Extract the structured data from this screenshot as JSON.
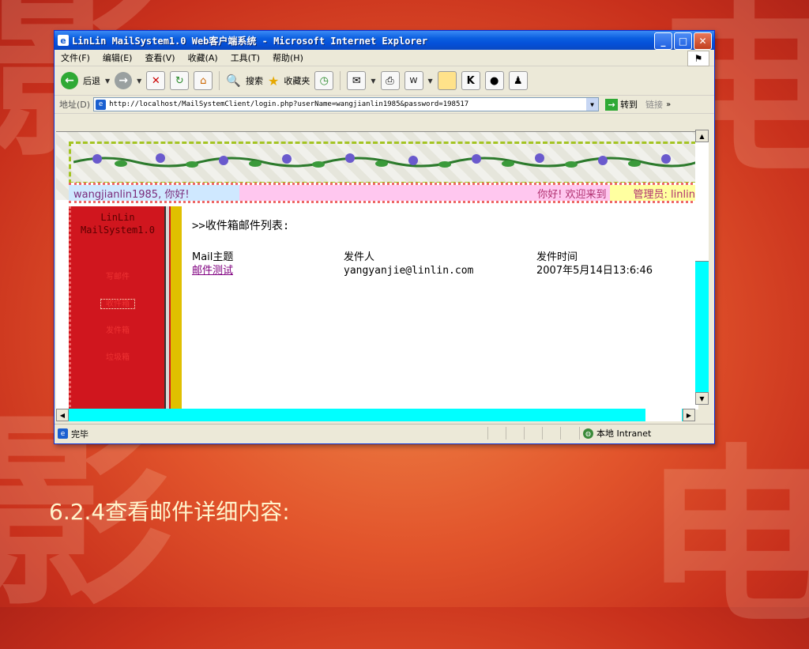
{
  "background": {
    "glyphs": [
      "影",
      "电",
      "影",
      "电"
    ]
  },
  "window": {
    "title": "LinLin MailSystem1.0 Web客户端系统 - Microsoft Internet Explorer",
    "buttons": {
      "minimize": "_",
      "maximize": "□",
      "close": "✕"
    }
  },
  "menu": {
    "items": [
      "文件(F)",
      "编辑(E)",
      "查看(V)",
      "收藏(A)",
      "工具(T)",
      "帮助(H)"
    ]
  },
  "toolbar": {
    "back_label": "后退",
    "search_label": "搜索",
    "favorites_label": "收藏夹"
  },
  "address": {
    "label": "地址(D)",
    "url": "http://localhost/MailSystemClient/login.php?userName=wangjianlin1985&password=198517",
    "go_label": "转到",
    "links_label": "链接"
  },
  "page": {
    "greeting_left": "wangjianlin1985, 你好!",
    "greeting_mid": "你好! 欢迎来到",
    "greeting_right": "管理员: linlin",
    "sidebar_title_line1": "LinLin",
    "sidebar_title_line2": "MailSystem1.0",
    "sidebar_items": [
      "写邮件",
      "收件箱",
      "发件箱",
      "垃圾箱"
    ],
    "heading": ">>收件箱邮件列表:",
    "table": {
      "headers": [
        "Mail主题",
        "发件人",
        "发件时间"
      ],
      "rows": [
        {
          "subject": "邮件测试",
          "sender": "yangyanjie@linlin.com",
          "time": "2007年5月14日13:6:46"
        }
      ]
    }
  },
  "status": {
    "text": "完毕",
    "zone": "本地 Intranet"
  },
  "caption": "6.2.4查看邮件详细内容:",
  "colors": {
    "sidebar": "#d0161e",
    "link_visited": "#800080",
    "scrollbar": "#00ffff"
  }
}
